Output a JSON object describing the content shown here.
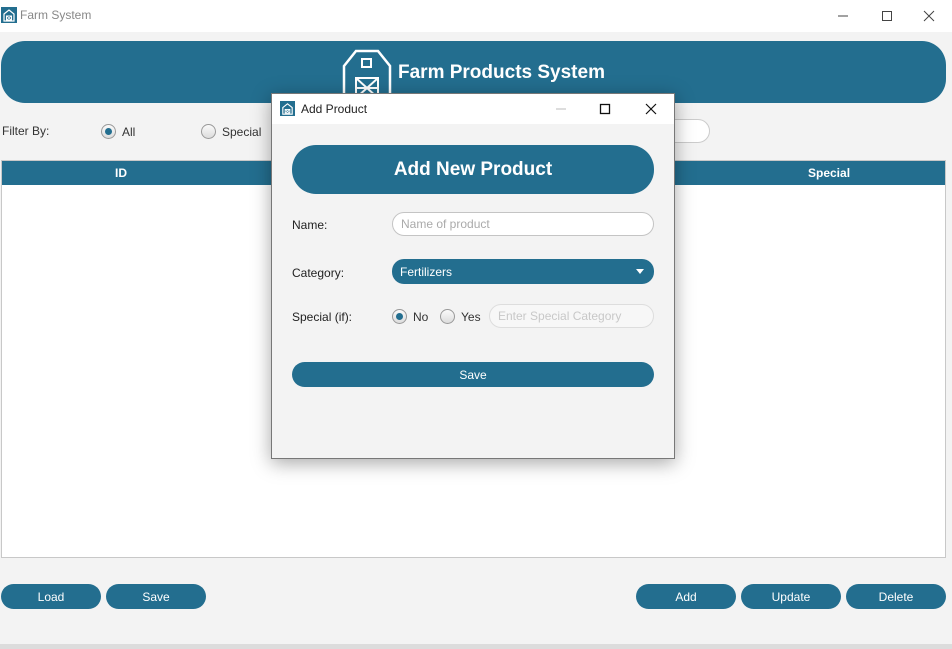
{
  "window": {
    "title": "Farm System"
  },
  "header": {
    "title": "Farm Products System"
  },
  "filter": {
    "label": "Filter By:",
    "options": [
      {
        "label": "All",
        "checked": true
      },
      {
        "label": "Special",
        "checked": false
      }
    ]
  },
  "table": {
    "columns": [
      "ID",
      "Special"
    ]
  },
  "buttons": {
    "load": "Load",
    "save": "Save",
    "add": "Add",
    "update": "Update",
    "delete": "Delete"
  },
  "dialog": {
    "title": "Add Product",
    "banner": "Add New Product",
    "name_label": "Name:",
    "name_placeholder": "Name of product",
    "category_label": "Category:",
    "category_value": "Fertilizers",
    "special_label": "Special (if):",
    "special_options": [
      {
        "label": "No",
        "checked": true
      },
      {
        "label": "Yes",
        "checked": false
      }
    ],
    "special_placeholder": "Enter Special Category",
    "save_label": "Save"
  },
  "colors": {
    "accent": "#236e8f",
    "background": "#f3f3f3"
  },
  "icons": [
    "barn-icon",
    "minimize-icon",
    "maximize-icon",
    "close-icon"
  ]
}
